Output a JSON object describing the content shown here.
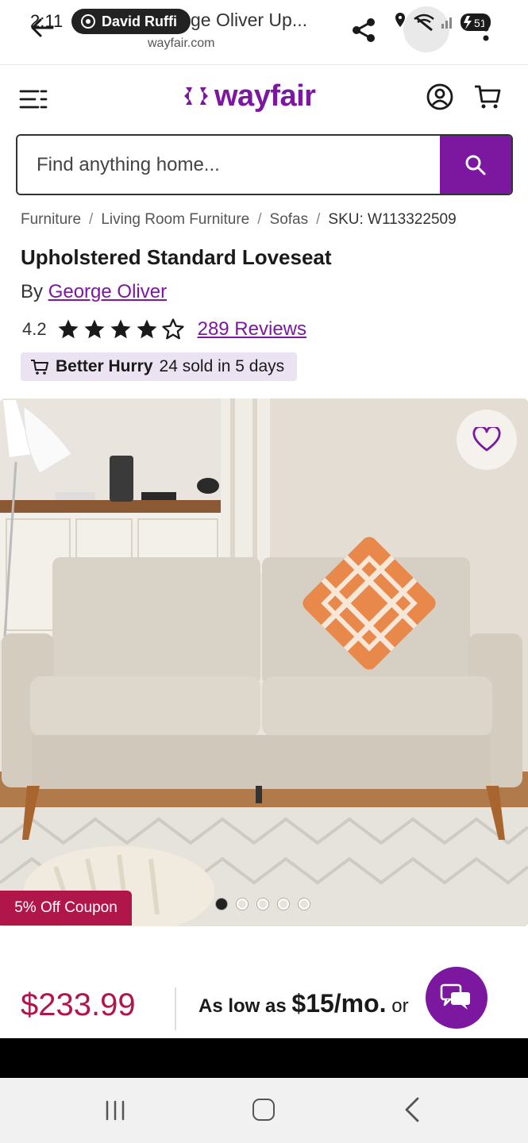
{
  "status_bar": {
    "time": "2:11",
    "battery": "51"
  },
  "browser": {
    "cast_label": "David Ruffi",
    "page_title": "ge Oliver Up...",
    "url": "wayfair.com"
  },
  "header": {
    "logo": "wayfair",
    "brand_color": "#7b189f"
  },
  "search": {
    "placeholder": "Find anything home..."
  },
  "breadcrumb": {
    "items": [
      "Furniture",
      "Living Room Furniture",
      "Sofas"
    ],
    "sku": "SKU: W113322509",
    "separator": "/"
  },
  "product": {
    "title": "Upholstered Standard Loveseat",
    "by_prefix": "By",
    "brand": "George Oliver",
    "rating": "4.2",
    "rating_value": 4.2,
    "reviews": "289 Reviews",
    "hurry_bold": "Better Hurry",
    "hurry_text": "24 sold in 5 days"
  },
  "gallery": {
    "coupon": "5% Off Coupon",
    "dot_count": 5,
    "active_dot": 0
  },
  "pricing": {
    "price": "$233.99",
    "financing_prefix": "As low as",
    "financing_amount": "$15/mo.",
    "financing_suffix": "or",
    "price_color": "#b1164b"
  }
}
